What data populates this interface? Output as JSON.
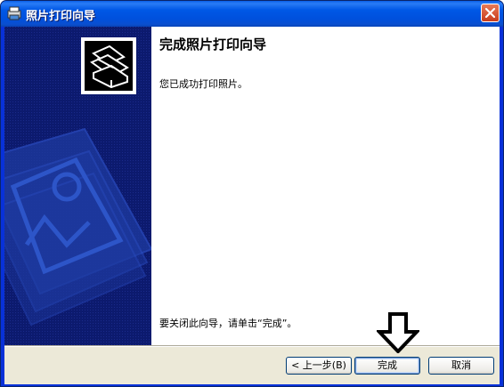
{
  "window": {
    "title": "照片打印向导",
    "title_icon": "wizard-app-icon",
    "close_icon": "close-x-icon"
  },
  "side_panel": {
    "graphic": "printer-photo-graphic",
    "background": "#0c1a6e"
  },
  "content": {
    "heading": "完成照片打印向导",
    "message": "您已成功打印照片。",
    "close_hint": "要关闭此向导，请单击“完成”。"
  },
  "buttons": {
    "back": "< 上一步(B)",
    "finish": "完成",
    "cancel": "取消"
  },
  "annotation": {
    "type": "arrow-down-icon",
    "color": "#000000"
  },
  "colors": {
    "titlebar": "#0058e6",
    "dialog": "#ece9d8",
    "close_button": "#d8532e"
  }
}
